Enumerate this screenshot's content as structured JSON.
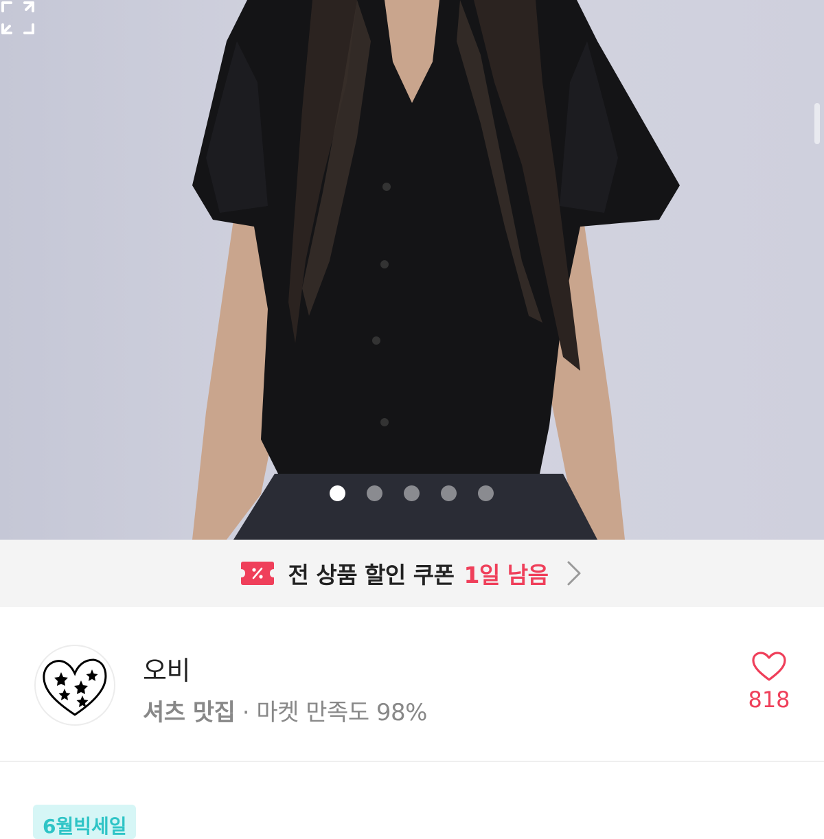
{
  "gallery": {
    "dot_count": 5,
    "active_index": 0
  },
  "coupon": {
    "text": "전 상품 할인 쿠폰",
    "remaining": "1일 남음",
    "accent_color": "#ef3f5a"
  },
  "store": {
    "name": "오비",
    "tagline": "셔츠 맛집",
    "separator": " · ",
    "satisfaction": "마켓 만족도 98%",
    "likes": "818"
  },
  "badge": {
    "label": "6월빅세일"
  },
  "icons": {
    "expand": "expand-icon",
    "coupon": "coupon-icon",
    "chevron": "chevron-right-icon",
    "heart": "heart-icon"
  }
}
